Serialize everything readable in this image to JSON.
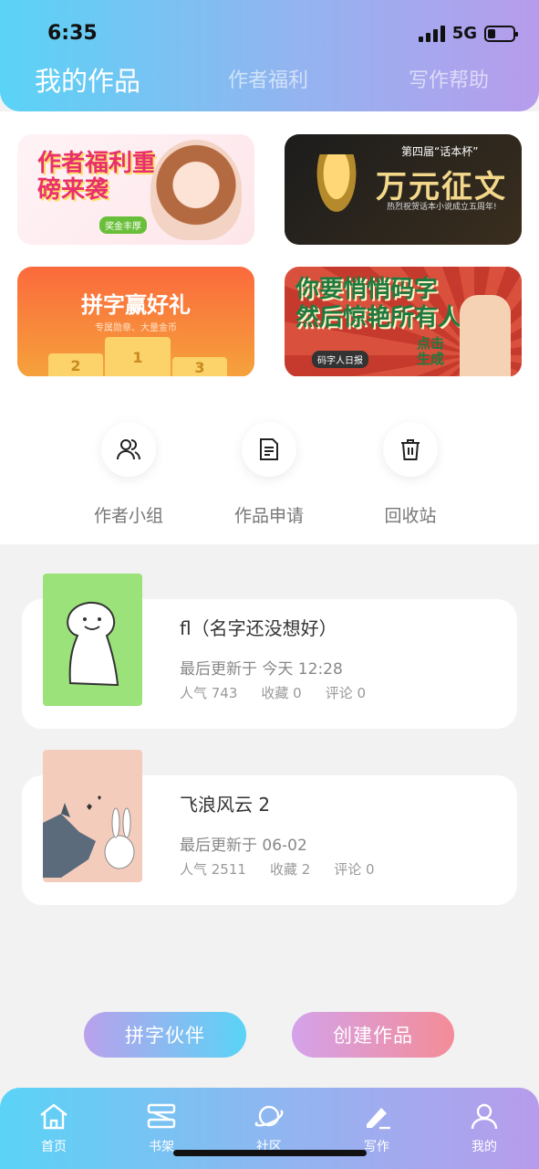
{
  "status": {
    "time": "6:35",
    "network": "5G",
    "battery_level": 0.3
  },
  "header": {
    "tabs": [
      {
        "label": "我的作品",
        "active": true
      },
      {
        "label": "作者福利",
        "active": false
      },
      {
        "label": "写作帮助",
        "active": false
      }
    ]
  },
  "banners": {
    "b1": {
      "title": "作者福利重磅来袭",
      "tag": "奖金丰厚"
    },
    "b2": {
      "subtitle": "第四届“话本杯”",
      "title": "万元征文",
      "note": "热烈祝贺话本小说成立五周年!"
    },
    "b3": {
      "title": "拼字赢好礼",
      "subtitle": "专属勋章、大量金币",
      "podium": [
        "2",
        "1",
        "3"
      ]
    },
    "b4": {
      "title_line1": "你要悄悄码字",
      "title_line2": "然后惊艳所有人",
      "tag": "码字人日报",
      "click": "点击生成"
    }
  },
  "actions": [
    {
      "label": "作者小组",
      "icon": "group-icon"
    },
    {
      "label": "作品申请",
      "icon": "document-icon"
    },
    {
      "label": "回收站",
      "icon": "trash-icon"
    }
  ],
  "works": [
    {
      "title": "fl（名字还没想好）",
      "updated": "最后更新于 今天 12:28",
      "popularity": "人气 743",
      "favorites": "收藏 0",
      "comments": "评论 0"
    },
    {
      "title": "飞浪风云 2",
      "updated": "最后更新于 06-02",
      "popularity": "人气 2511",
      "favorites": "收藏 2",
      "comments": "评论 0"
    }
  ],
  "buttons": {
    "partner": "拼字伙伴",
    "create": "创建作品"
  },
  "tabbar": [
    {
      "label": "首页",
      "icon": "home-icon"
    },
    {
      "label": "书架",
      "icon": "bookshelf-icon"
    },
    {
      "label": "社区",
      "icon": "planet-icon"
    },
    {
      "label": "写作",
      "icon": "pen-icon"
    },
    {
      "label": "我的",
      "icon": "user-icon"
    }
  ]
}
